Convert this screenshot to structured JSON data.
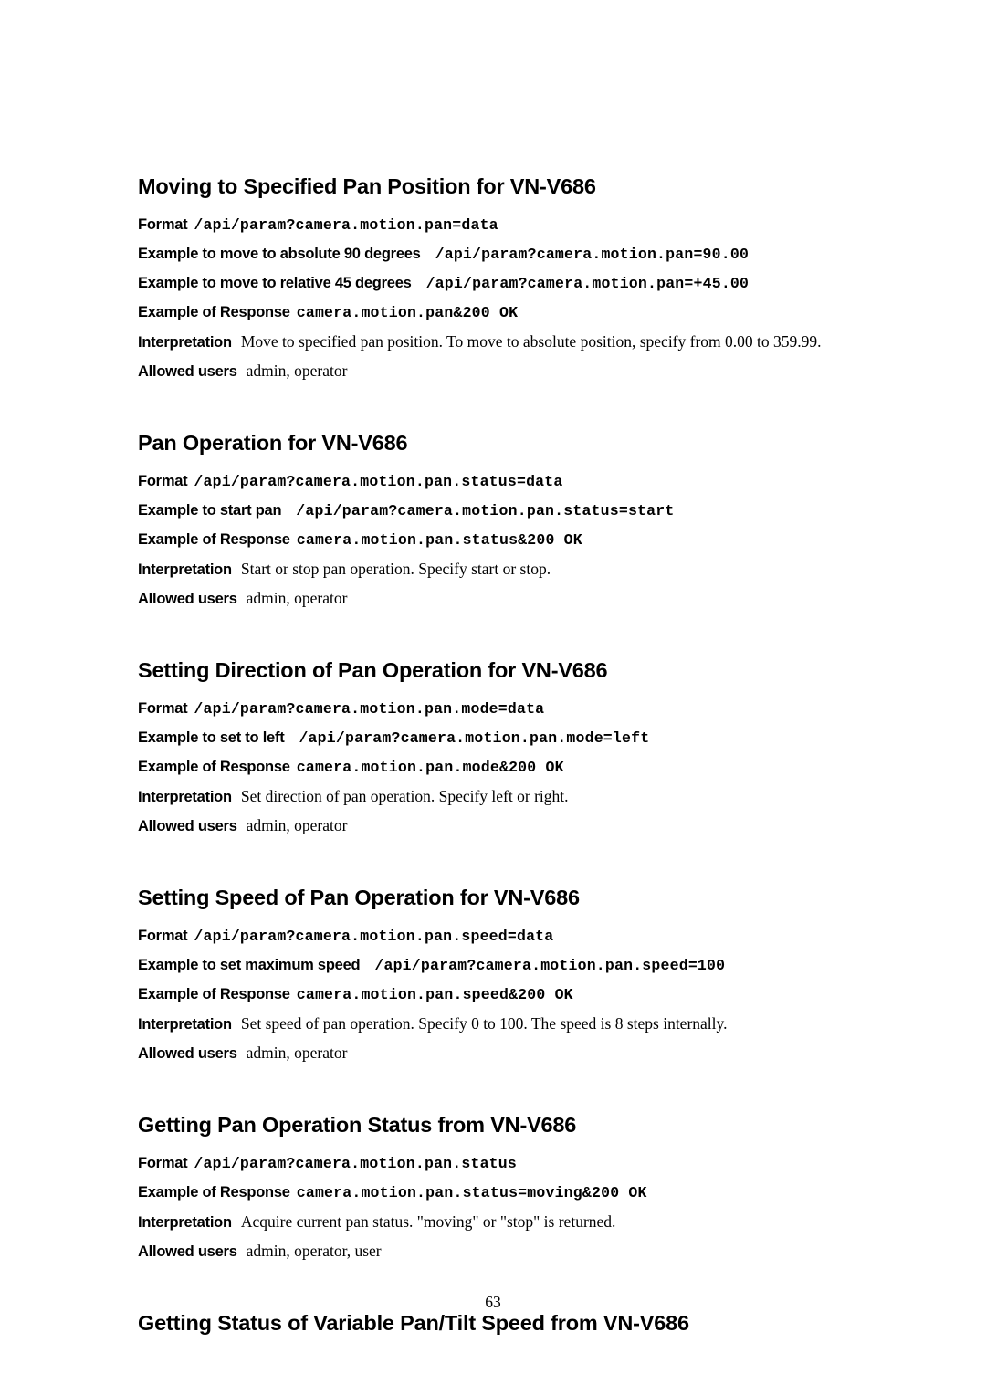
{
  "document": {
    "page_number": "63"
  },
  "sections": [
    {
      "heading": "Moving to Specified Pan Position for VN-V686",
      "rows": [
        {
          "label": "Format",
          "mono": "/api/param?camera.motion.pan=data",
          "gap": "small"
        },
        {
          "label": "Example to move to absolute 90 degrees",
          "mono": "/api/param?camera.motion.pan=90.00",
          "gap": "large"
        },
        {
          "label": "Example to move to relative 45 degrees",
          "mono": "/api/param?camera.motion.pan=+45.00",
          "gap": "large"
        },
        {
          "label": "Example of Response",
          "mono": "camera.motion.pan&200 OK",
          "gap": "small"
        },
        {
          "label": "Interpretation",
          "serif": "Move to specified pan position. To move to absolute position, specify from 0.00 to 359.99.",
          "gap": "medium"
        },
        {
          "label": "Allowed users",
          "serif": "admin, operator",
          "gap": "medium"
        }
      ]
    },
    {
      "heading": "Pan Operation for VN-V686",
      "rows": [
        {
          "label": "Format",
          "mono": "/api/param?camera.motion.pan.status=data",
          "gap": "small"
        },
        {
          "label": "Example to start pan",
          "mono": "/api/param?camera.motion.pan.status=start",
          "gap": "large"
        },
        {
          "label": "Example of Response",
          "mono": "camera.motion.pan.status&200 OK",
          "gap": "small"
        },
        {
          "label": "Interpretation",
          "serif": "Start or stop pan operation. Specify start or stop.",
          "gap": "medium"
        },
        {
          "label": "Allowed users",
          "serif": "admin, operator",
          "gap": "medium"
        }
      ]
    },
    {
      "heading": "Setting Direction of Pan Operation for VN-V686",
      "rows": [
        {
          "label": "Format",
          "mono": "/api/param?camera.motion.pan.mode=data",
          "gap": "small"
        },
        {
          "label": "Example to set to left",
          "mono": "/api/param?camera.motion.pan.mode=left",
          "gap": "large"
        },
        {
          "label": "Example of Response",
          "mono": "camera.motion.pan.mode&200 OK",
          "gap": "small"
        },
        {
          "label": "Interpretation",
          "serif": "Set direction of pan operation. Specify left or right.",
          "gap": "medium"
        },
        {
          "label": "Allowed users",
          "serif": "admin, operator",
          "gap": "medium"
        }
      ]
    },
    {
      "heading": "Setting Speed of Pan Operation for VN-V686",
      "rows": [
        {
          "label": "Format",
          "mono": "/api/param?camera.motion.pan.speed=data",
          "gap": "small"
        },
        {
          "label": "Example to set maximum speed",
          "mono": "/api/param?camera.motion.pan.speed=100",
          "gap": "large"
        },
        {
          "label": "Example of Response",
          "mono": "camera.motion.pan.speed&200 OK",
          "gap": "small"
        },
        {
          "label": "Interpretation",
          "serif": "Set speed of pan operation. Specify 0 to 100. The speed is 8 steps internally.",
          "gap": "medium"
        },
        {
          "label": "Allowed users",
          "serif": "admin, operator",
          "gap": "medium"
        }
      ]
    },
    {
      "heading": "Getting Pan Operation Status from VN-V686",
      "rows": [
        {
          "label": "Format",
          "mono": "/api/param?camera.motion.pan.status",
          "gap": "small"
        },
        {
          "label": "Example of Response",
          "mono": "camera.motion.pan.status=moving&200 OK",
          "gap": "small"
        },
        {
          "label": "Interpretation",
          "serif": "Acquire current pan status. \"moving\" or \"stop\" is returned.",
          "gap": "medium"
        },
        {
          "label": "Allowed users",
          "serif": "admin, operator, user",
          "gap": "medium"
        }
      ]
    },
    {
      "heading": "Getting Status of Variable Pan/Tilt Speed from VN-V686",
      "rows": []
    }
  ]
}
